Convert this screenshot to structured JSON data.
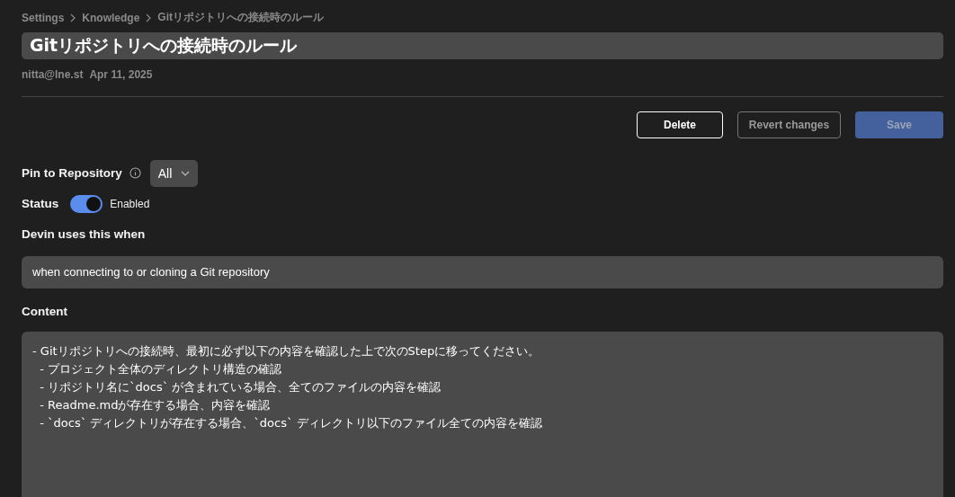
{
  "breadcrumb": [
    "Settings",
    "Knowledge",
    "Gitリポジトリへの接続時のルール"
  ],
  "title": "Gitリポジトリへの接続時のルール",
  "meta": {
    "author": "nitta@lne.st",
    "date": "Apr 11, 2025"
  },
  "buttons": [
    {
      "label": "Delete",
      "kind": "outline",
      "disabled": false
    },
    {
      "label": "Revert changes",
      "kind": "outline",
      "disabled": true
    },
    {
      "label": "Save",
      "kind": "primary",
      "disabled": true
    }
  ],
  "pin": {
    "label": "Pin to Repository",
    "value": "All"
  },
  "status": {
    "label": "Status",
    "on": true,
    "text": "Enabled"
  },
  "trigger": {
    "label": "Devin uses this when",
    "value": "when connecting to or cloning a Git repository"
  },
  "content": {
    "label": "Content",
    "value": "- Gitリポジトリへの接続時、最初に必ず以下の内容を確認した上で次のStepに移ってください。\n  - プロジェクト全体のディレクトリ構造の確認\n  - リポジトリ名に`docs` が含まれている場合、全てのファイルの内容を確認\n  - Readme.mdが存在する場合、内容を確認\n  - `docs` ディレクトリが存在する場合、`docs` ディレクトリ以下のファイル全ての内容を確認"
  }
}
